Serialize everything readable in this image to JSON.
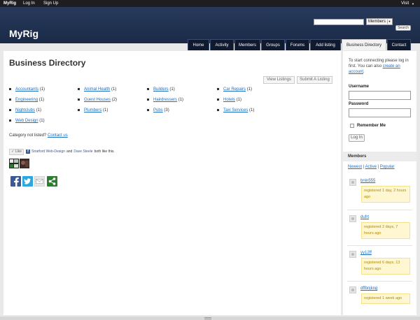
{
  "admin_bar": {
    "brand": "MyRig",
    "login": "Log In",
    "signup": "Sign Up",
    "visit": "Visit"
  },
  "header": {
    "logo": "MyRig",
    "search": {
      "placeholder": "",
      "scope": "Members",
      "button": "Search"
    },
    "nav": [
      "Home",
      "Activity",
      "Members",
      "Groups",
      "Forums",
      "Add listing",
      "Business Directory",
      "Contact"
    ],
    "active_nav": "Business Directory"
  },
  "main": {
    "title": "Business Directory",
    "view_listings": "View Listings",
    "submit_listing": "Submit A Listing",
    "categories": [
      {
        "name": "Accountants",
        "count": "(1)"
      },
      {
        "name": "Animal Health",
        "count": "(1)"
      },
      {
        "name": "Builders",
        "count": "(1)"
      },
      {
        "name": "Car Repairs",
        "count": "(1)"
      },
      {
        "name": "Engineering",
        "count": "(1)"
      },
      {
        "name": "Guest Houses",
        "count": "(2)"
      },
      {
        "name": "Hairdressers",
        "count": "(1)"
      },
      {
        "name": "Hotels",
        "count": "(1)"
      },
      {
        "name": "Nightclubs",
        "count": "(1)"
      },
      {
        "name": "Plumbers",
        "count": "(1)"
      },
      {
        "name": "Pubs",
        "count": "(3)"
      },
      {
        "name": "Taxi Services",
        "count": "(1)"
      },
      {
        "name": "Web Design",
        "count": "(1)"
      }
    ],
    "not_listed": "Category not listed?",
    "contact_link": "Contact us",
    "like": {
      "button": "Like",
      "user1": "Stratford Web-Design",
      "and": "and",
      "user2": "Dave Steele",
      "suffix": "both like this."
    },
    "share_icons": [
      "facebook-icon",
      "twitter-icon",
      "email-icon",
      "share-icon"
    ],
    "colors": {
      "facebook": "#3b5998",
      "twitter": "#2ca7e0",
      "share": "#2e7d32"
    }
  },
  "sidebar": {
    "login_prompt": "To start connecting please log in first. You can also",
    "create_account": "create an account",
    "username_label": "Username",
    "password_label": "Password",
    "remember_me": "Remember Me",
    "login_button": "Log In",
    "members_title": "Members",
    "filters": [
      "Newest",
      "Active",
      "Popular"
    ],
    "members": [
      {
        "name": "bnin555",
        "since": "registered 1 day, 2 hours ago"
      },
      {
        "name": "dufrt",
        "since": "registered 2 days, 7 hours ago"
      },
      {
        "name": "yy12ff",
        "since": "registered 6 days, 13 hours ago"
      },
      {
        "name": "dffbnjkng",
        "since": "registered 1 week ago"
      }
    ]
  }
}
